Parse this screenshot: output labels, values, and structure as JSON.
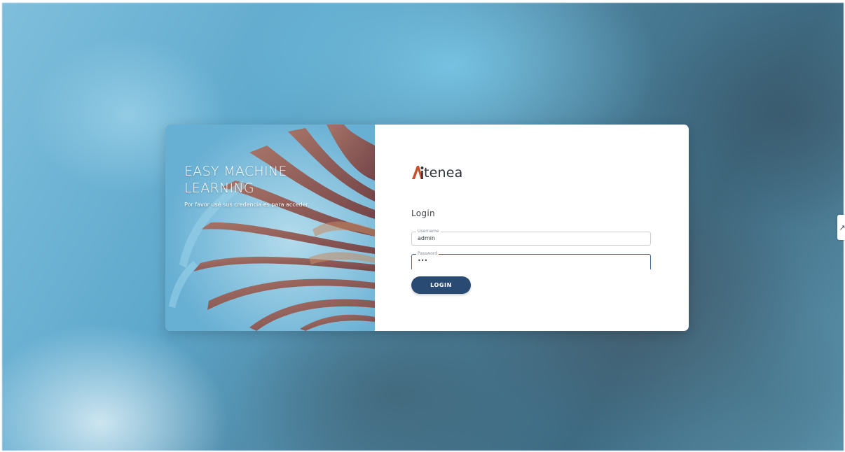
{
  "hero": {
    "title": "EASY MACHINE LEARNING",
    "subtitle": "Por favor usé sus credencia es para acceder."
  },
  "brand": {
    "logo_text": "tenea",
    "logo_mark_color": "#c8502a"
  },
  "form": {
    "heading": "Login",
    "username_label": "Username",
    "username_value": "admin",
    "password_label": "Password",
    "password_value": "•••",
    "submit_label": "LOGIN"
  },
  "colors": {
    "button": "#284a73",
    "focus_border": "#3d6a96"
  },
  "side_tab": {
    "icon": "expand-icon"
  }
}
